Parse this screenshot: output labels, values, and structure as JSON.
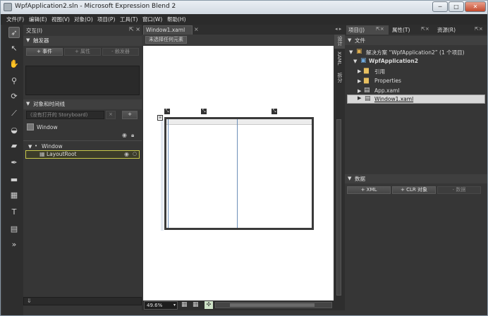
{
  "window": {
    "title": "WpfApplication2.sln - Microsoft Expression Blend 2",
    "minimize": "─",
    "maximize": "□",
    "close": "✕"
  },
  "menu": [
    "文件(F)",
    "编辑(E)",
    "视图(V)",
    "对象(O)",
    "项目(P)",
    "工具(T)",
    "窗口(W)",
    "帮助(H)"
  ],
  "interaction_panel": {
    "title": "交互(I)",
    "triggers_header": "触发器",
    "add_event": "+ 事件",
    "add_property": "+ 属性",
    "remove_trigger": "- 触发器",
    "objects_header": "对象和时间线",
    "storyboard": "(没有打开的 Storyboard)",
    "storyboard_close": "×",
    "storyboard_add": "+",
    "root_item": "Window",
    "tree_window": "Window",
    "tree_layoutroot": "LayoutRoot"
  },
  "document": {
    "tab": "Window1.xaml",
    "tab_close": "×",
    "breadcrumb": "未选择任何元素",
    "zoom": "49.6%",
    "vertical_tabs": [
      "设计",
      "XAML",
      "拆分"
    ]
  },
  "project_panel": {
    "tabs": [
      "项目(J)",
      "属性(T)",
      "资源(R)"
    ],
    "files_header": "文件",
    "solution": "解决方案 “WpfApplication2” (1 个项目)",
    "project": "WpfApplication2",
    "items": [
      "引用",
      "Properties",
      "App.xaml",
      "Window1.xaml"
    ]
  },
  "data_panel": {
    "header": "数据",
    "add_xml": "+ XML",
    "add_clr": "+ CLR 对象",
    "remove": "- 数据"
  },
  "colors": {
    "panel_bg": "#363636",
    "dark_bg": "#2a2a2a",
    "selection_border": "#c8c84a",
    "selected_row": "#d8d8d8"
  }
}
